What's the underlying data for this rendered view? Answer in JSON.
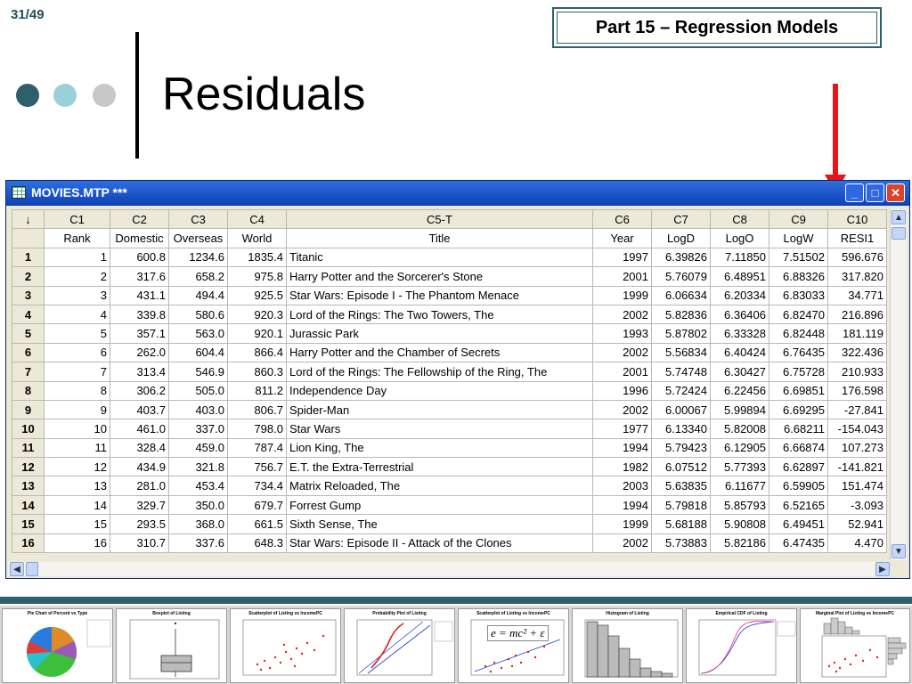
{
  "slide": {
    "number": "31/49",
    "badge": "Part 15 – Regression Models",
    "title": "Residuals",
    "dot_colors": [
      "#2f5f6a",
      "#9ad0d8",
      "#c8c8c8"
    ],
    "arrow_color": "#e3161b"
  },
  "window": {
    "title": "MOVIES.MTP ***",
    "buttons": {
      "minimize": "_",
      "maximize": "□",
      "close": "✕"
    }
  },
  "sheet": {
    "corner": "↓",
    "col_ids": [
      "C1",
      "C2",
      "C3",
      "C4",
      "C5-T",
      "C6",
      "C7",
      "C8",
      "C9",
      "C10"
    ],
    "col_names": [
      "Rank",
      "Domestic",
      "Overseas",
      "World",
      "Title",
      "Year",
      "LogD",
      "LogO",
      "LogW",
      "RESI1"
    ],
    "rows": [
      [
        "1",
        "1",
        "600.8",
        "1234.6",
        "1835.4",
        "Titanic",
        "1997",
        "6.39826",
        "7.11850",
        "7.51502",
        "596.676"
      ],
      [
        "2",
        "2",
        "317.6",
        "658.2",
        "975.8",
        "Harry Potter and the Sorcerer's Stone",
        "2001",
        "5.76079",
        "6.48951",
        "6.88326",
        "317.820"
      ],
      [
        "3",
        "3",
        "431.1",
        "494.4",
        "925.5",
        "Star Wars: Episode I - The Phantom Menace",
        "1999",
        "6.06634",
        "6.20334",
        "6.83033",
        "34.771"
      ],
      [
        "4",
        "4",
        "339.8",
        "580.6",
        "920.3",
        "Lord of the Rings: The Two Towers, The",
        "2002",
        "5.82836",
        "6.36406",
        "6.82470",
        "216.896"
      ],
      [
        "5",
        "5",
        "357.1",
        "563.0",
        "920.1",
        "Jurassic Park",
        "1993",
        "5.87802",
        "6.33328",
        "6.82448",
        "181.119"
      ],
      [
        "6",
        "6",
        "262.0",
        "604.4",
        "866.4",
        "Harry Potter and the Chamber of Secrets",
        "2002",
        "5.56834",
        "6.40424",
        "6.76435",
        "322.436"
      ],
      [
        "7",
        "7",
        "313.4",
        "546.9",
        "860.3",
        "Lord of the Rings: The Fellowship of the Ring, The",
        "2001",
        "5.74748",
        "6.30427",
        "6.75728",
        "210.933"
      ],
      [
        "8",
        "8",
        "306.2",
        "505.0",
        "811.2",
        "Independence Day",
        "1996",
        "5.72424",
        "6.22456",
        "6.69851",
        "176.598"
      ],
      [
        "9",
        "9",
        "403.7",
        "403.0",
        "806.7",
        "Spider-Man",
        "2002",
        "6.00067",
        "5.99894",
        "6.69295",
        "-27.841"
      ],
      [
        "10",
        "10",
        "461.0",
        "337.0",
        "798.0",
        "Star Wars",
        "1977",
        "6.13340",
        "5.82008",
        "6.68211",
        "-154.043"
      ],
      [
        "11",
        "11",
        "328.4",
        "459.0",
        "787.4",
        "Lion King, The",
        "1994",
        "5.79423",
        "6.12905",
        "6.66874",
        "107.273"
      ],
      [
        "12",
        "12",
        "434.9",
        "321.8",
        "756.7",
        "E.T. the Extra-Terrestrial",
        "1982",
        "6.07512",
        "5.77393",
        "6.62897",
        "-141.821"
      ],
      [
        "13",
        "13",
        "281.0",
        "453.4",
        "734.4",
        "Matrix Reloaded, The",
        "2003",
        "5.63835",
        "6.11677",
        "6.59905",
        "151.474"
      ],
      [
        "14",
        "14",
        "329.7",
        "350.0",
        "679.7",
        "Forrest Gump",
        "1994",
        "5.79818",
        "5.85793",
        "6.52165",
        "-3.093"
      ],
      [
        "15",
        "15",
        "293.5",
        "368.0",
        "661.5",
        "Sixth Sense, The",
        "1999",
        "5.68188",
        "5.90808",
        "6.49451",
        "52.941"
      ],
      [
        "16",
        "16",
        "310.7",
        "337.6",
        "648.3",
        "Star Wars: Episode II - Attack of the Clones",
        "2002",
        "5.73883",
        "5.82186",
        "6.47435",
        "4.470"
      ]
    ]
  },
  "thumbnails": [
    {
      "title": "Pie Chart of Percent vs Type"
    },
    {
      "title": "Boxplot of Listing"
    },
    {
      "title": "Scatterplot of Listing vs IncomePC"
    },
    {
      "title": "Probability Plot of Listing"
    },
    {
      "title": "Scatterplot of Listing vs IncomePC",
      "formula": "e = mc² + ε"
    },
    {
      "title": "Histogram of Listing"
    },
    {
      "title": "Empirical CDF of Listing"
    },
    {
      "title": "Marginal Plot of Listing vs IncomePC"
    }
  ]
}
